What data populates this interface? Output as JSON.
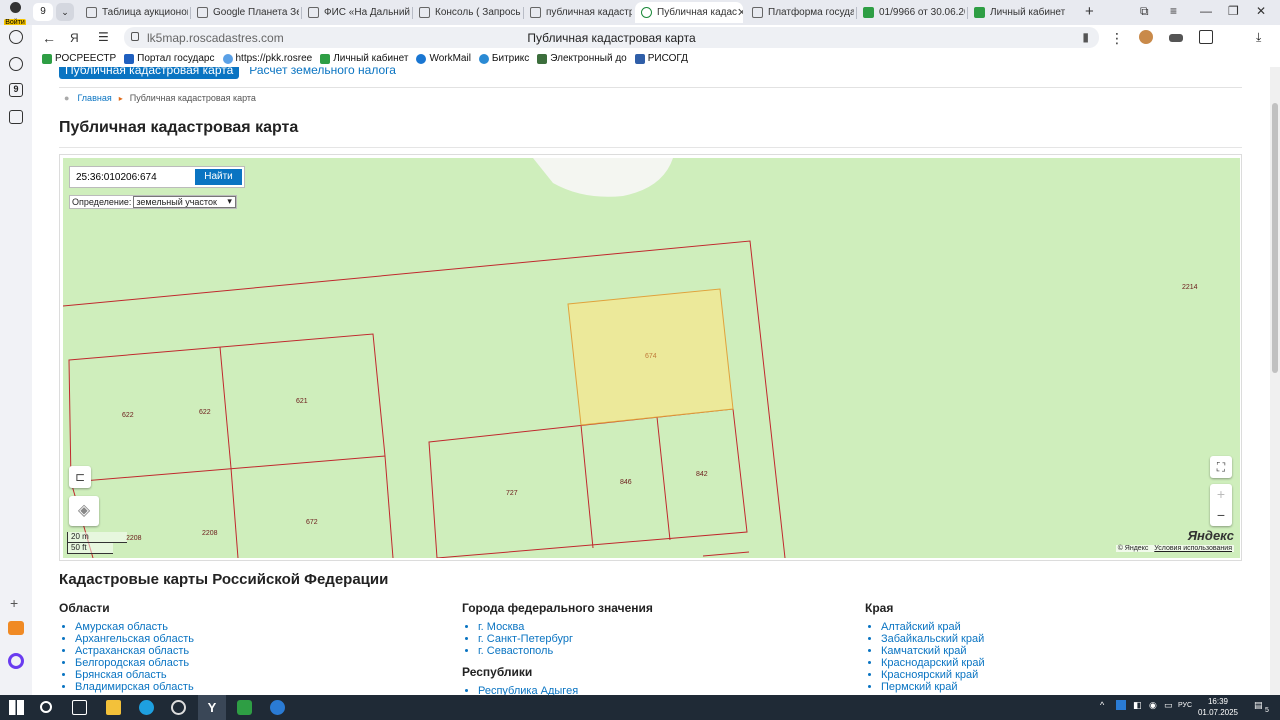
{
  "browser": {
    "profile_label": "Войти",
    "tab_count": "9",
    "tabs": [
      {
        "title": "Таблица аукционов"
      },
      {
        "title": "Google Планета Земля"
      },
      {
        "title": "ФИС «На Дальний Восток»"
      },
      {
        "title": "Консоль ( Запросы )"
      },
      {
        "title": "публичная кадастровая"
      },
      {
        "title": "Публичная кадас",
        "active": true
      },
      {
        "title": "Платформа государственных"
      },
      {
        "title": "01/9966 от 30.06.2025"
      },
      {
        "title": "Личный кабинет"
      }
    ],
    "url_domain": "lk5map.roscadastres.com",
    "page_title": "Публичная кадастровая карта",
    "bookmarks": [
      {
        "label": "РОСРЕЕСТР",
        "color": "#2e9e44"
      },
      {
        "label": "Портал государс",
        "color": "#1f5fbf"
      },
      {
        "label": "https://pkk.rosree",
        "color": "#5aa0e6"
      },
      {
        "label": "Личный кабинет",
        "color": "#2e9e44"
      },
      {
        "label": "WorkMail",
        "color": "#1976d2"
      },
      {
        "label": "Битрикс",
        "color": "#2a8ad4"
      },
      {
        "label": "Электронный до",
        "color": "#3c6e3c"
      },
      {
        "label": "РИСОГД",
        "color": "#2f5ea8"
      }
    ]
  },
  "page": {
    "top_button": "Публичная кадастровая карта",
    "top_link": "Расчет земельного налога",
    "breadcrumb_home": "Главная",
    "breadcrumb_current": "Публичная кадастровая карта",
    "title": "Публичная кадастровая карта",
    "search_value": "25:36:010206:674",
    "search_button": "Найти",
    "definition_label": "Определение:",
    "definition_value": "земельный участок",
    "scale_m": "20 m",
    "scale_ft": "50 ft",
    "yandex_logo": "Яндекс",
    "map_copyright": "© Яндекс",
    "map_terms": "Условия использования",
    "parcel_labels": [
      "674",
      "622",
      "622",
      "621",
      "727",
      "846",
      "842",
      "672",
      "2208",
      "2208",
      "2214"
    ],
    "section_title": "Кадастровые карты Российской Федерации",
    "columns": [
      {
        "heading": "Области",
        "items": [
          "Амурская область",
          "Архангельская область",
          "Астраханская область",
          "Белгородская область",
          "Брянская область",
          "Владимирская область"
        ]
      },
      {
        "heading": "Города федерального значения",
        "items": [
          "г. Москва",
          "г. Санкт-Петербург",
          "г. Севастополь"
        ],
        "heading2": "Республики",
        "items2": [
          "Республика Адыгея"
        ]
      },
      {
        "heading": "Края",
        "items": [
          "Алтайский край",
          "Забайкальский край",
          "Камчатский край",
          "Краснодарский край",
          "Красноярский край",
          "Пермский край"
        ]
      }
    ]
  },
  "taskbar": {
    "lang": "РУС",
    "time": "16:39",
    "date": "01.07.2025",
    "notifications": "5"
  },
  "colors": {
    "accent": "#0a74c2",
    "map_bg": "#cfeebc",
    "parcel_border": "#c0282d",
    "selected_parcel": "#ece99a"
  }
}
